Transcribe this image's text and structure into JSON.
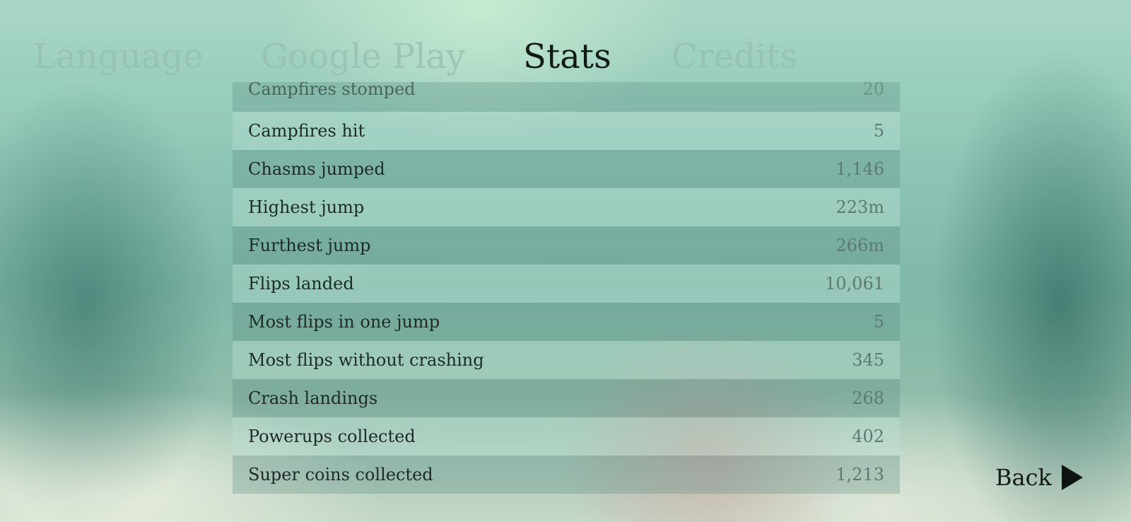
{
  "tabs": {
    "language": "Language",
    "google_play": "Google Play",
    "stats": "Stats",
    "credits": "Credits",
    "active": "Stats"
  },
  "stats": [
    {
      "label": "Campfires stomped",
      "value": "20"
    },
    {
      "label": "Campfires hit",
      "value": "5"
    },
    {
      "label": "Chasms jumped",
      "value": "1,146"
    },
    {
      "label": "Highest jump",
      "value": "223m"
    },
    {
      "label": "Furthest jump",
      "value": "266m"
    },
    {
      "label": "Flips landed",
      "value": "10,061"
    },
    {
      "label": "Most flips in one jump",
      "value": "5"
    },
    {
      "label": "Most flips without crashing",
      "value": "345"
    },
    {
      "label": "Crash landings",
      "value": "268"
    },
    {
      "label": "Powerups collected",
      "value": "402"
    },
    {
      "label": "Super coins collected",
      "value": "1,213"
    }
  ],
  "back_button": {
    "label": "Back",
    "icon": "play-triangle-icon"
  },
  "colors": {
    "active_tab": "#121a17",
    "inactive_tab": "#9cc2b3",
    "row_label": "#1e2a26",
    "row_value": "#5d7a72"
  }
}
